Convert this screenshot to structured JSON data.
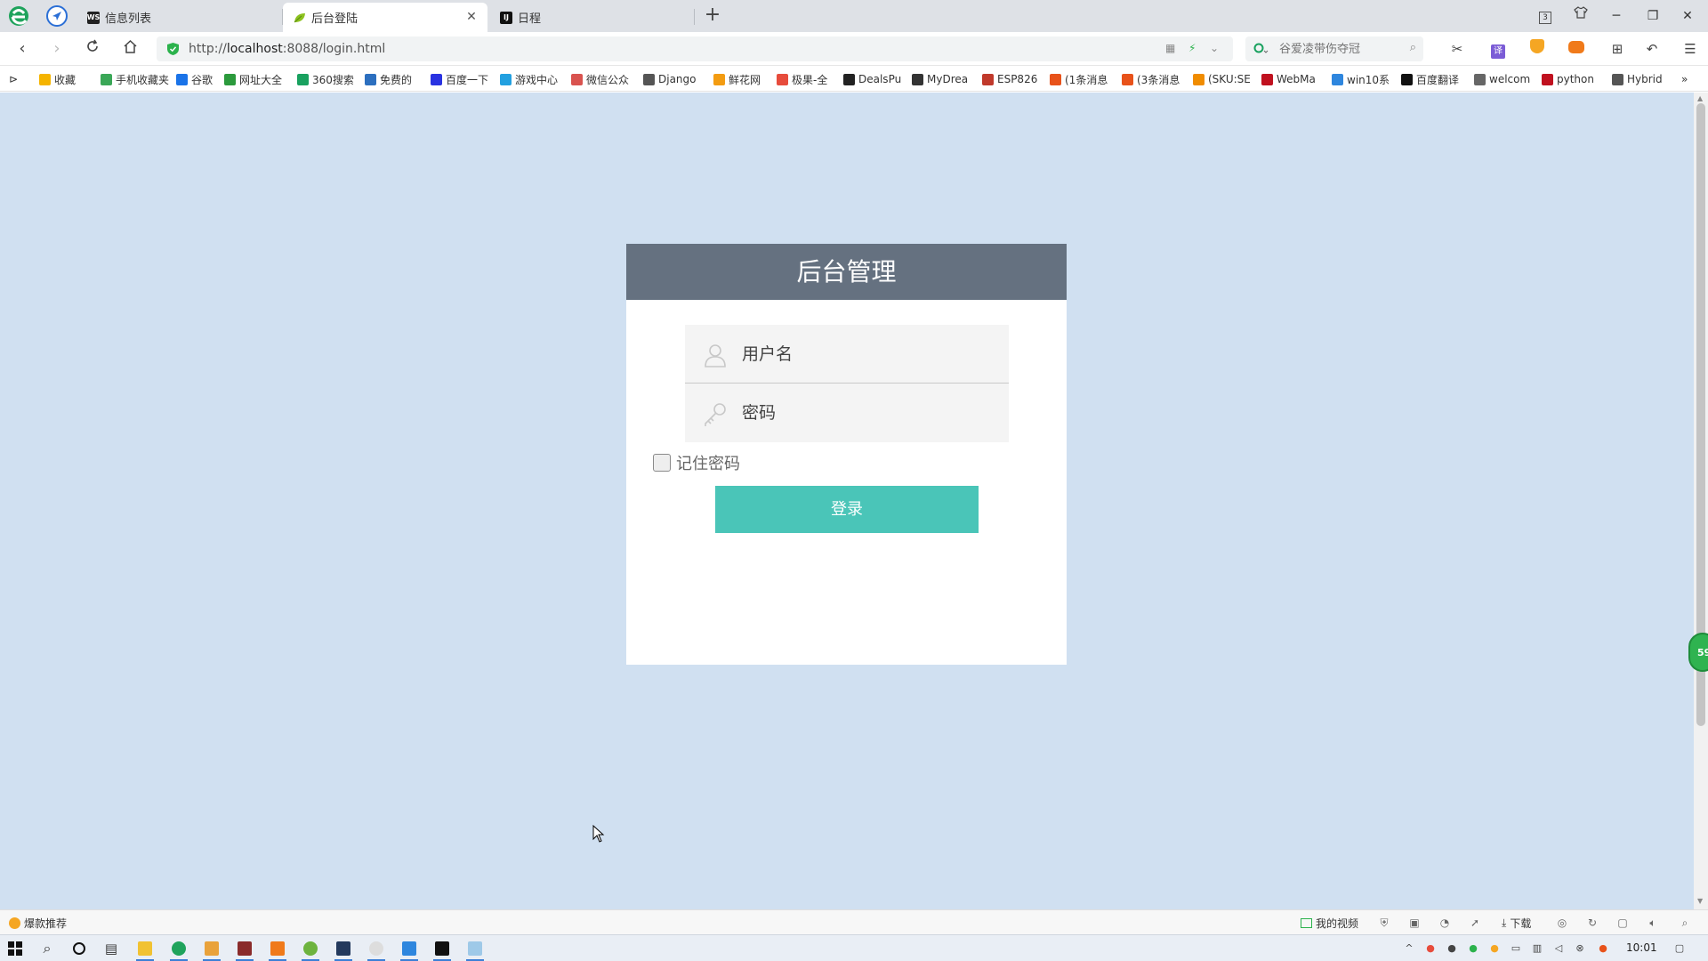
{
  "browser": {
    "tabs": [
      {
        "label": "信息列表",
        "favicon": "ws-logo-icon",
        "active": false
      },
      {
        "label": "后台登陆",
        "favicon": "leaf-icon",
        "active": true
      },
      {
        "label": "日程",
        "favicon": "intellij-icon",
        "active": false
      }
    ],
    "tab_count_badge": "3",
    "url": {
      "prefix": "http://",
      "host": "localhost",
      "rest": ":8088/login.html"
    },
    "search_placeholder": "谷爱凌带伤夺冠",
    "bookmarks": [
      {
        "label": "收藏",
        "color": "#f5b400"
      },
      {
        "label": "手机收藏夹",
        "color": "#3aa757"
      },
      {
        "label": "谷歌",
        "color": "#1a73e8"
      },
      {
        "label": "网址大全",
        "color": "#2b9a3c"
      },
      {
        "label": "360搜索",
        "color": "#19a15f"
      },
      {
        "label": "免费的",
        "color": "#2c6fbf"
      },
      {
        "label": "百度一下",
        "color": "#2932e1"
      },
      {
        "label": "游戏中心",
        "color": "#22a0e0"
      },
      {
        "label": "微信公众",
        "color": "#d9534f"
      },
      {
        "label": "Django",
        "color": "#555555"
      },
      {
        "label": "鲜花网",
        "color": "#f39c12"
      },
      {
        "label": "极果-全",
        "color": "#e74c3c"
      },
      {
        "label": "DealsPu",
        "color": "#222222"
      },
      {
        "label": "MyDrea",
        "color": "#333333"
      },
      {
        "label": "ESP826",
        "color": "#c0392b"
      },
      {
        "label": "(1条消息",
        "color": "#e8521a"
      },
      {
        "label": "(3条消息",
        "color": "#e8521a"
      },
      {
        "label": "(SKU:SE",
        "color": "#f08c00"
      },
      {
        "label": "WebMa",
        "color": "#c0111f"
      },
      {
        "label": "win10系",
        "color": "#2e86de"
      },
      {
        "label": "百度翻译",
        "color": "#111111"
      },
      {
        "label": "welcom",
        "color": "#666666"
      },
      {
        "label": "python",
        "color": "#c0111f"
      },
      {
        "label": "Hybrid",
        "color": "#555555"
      }
    ],
    "more_bookmarks": "»"
  },
  "login": {
    "title": "后台管理",
    "username_placeholder": "用户名",
    "password_placeholder": "密码",
    "remember_label": "记住密码",
    "remember_checked": false,
    "submit_label": "登录"
  },
  "floating_widget": {
    "value": "59"
  },
  "statusbar": {
    "left_label": "爆款推荐",
    "my_video": "我的视频",
    "download": "下载"
  },
  "taskbar": {
    "clock": "10:01"
  },
  "colors": {
    "page_bg": "#d0e0f1",
    "card_header": "#657180",
    "login_button": "#4ac5b8",
    "field_bg": "#f4f4f4"
  }
}
